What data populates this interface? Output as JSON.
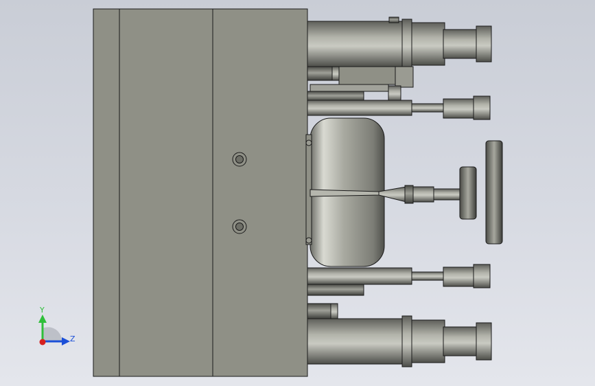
{
  "viewport": {
    "background_top": "#c9cdd6",
    "background_bottom": "#e4e6ec",
    "part_color": "#8f9086",
    "edge_color": "#1a1a1a"
  },
  "triad": {
    "y_label": "Y",
    "z_label": "Z",
    "y_color": "#2fbf3a",
    "z_color": "#1b4fd8",
    "x_color": "#d62020"
  }
}
